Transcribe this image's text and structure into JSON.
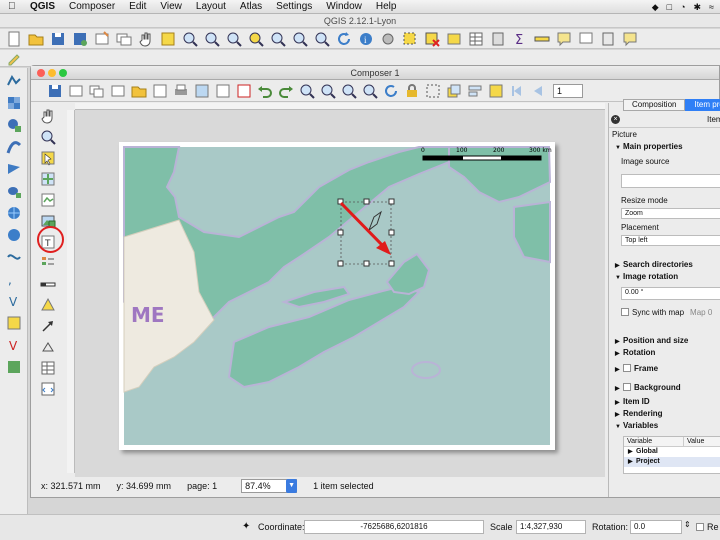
{
  "menubar": {
    "items": [
      "QGIS",
      "Composer",
      "Edit",
      "View",
      "Layout",
      "Atlas",
      "Settings",
      "Window",
      "Help"
    ]
  },
  "main_window": {
    "title": "QGIS 2.12.1-Lyon"
  },
  "composer": {
    "title": "Composer 1",
    "page_number": "1",
    "map": {
      "scalebar_ticks": [
        "0",
        "100",
        "200",
        "300 km"
      ],
      "label_me": "ME"
    }
  },
  "status": {
    "x": "x: 321.571 mm",
    "y": "y: 34.699 mm",
    "page": "page: 1",
    "zoom": "87.4%",
    "selection": "1 item selected"
  },
  "right_panel": {
    "tab_composition": "Composition",
    "tab_item": "Item pro",
    "header": "Item",
    "section_title": "Picture",
    "main_properties": "Main properties",
    "image_source_label": "Image source",
    "resize_mode_label": "Resize mode",
    "resize_mode_value": "Zoom",
    "placement_label": "Placement",
    "placement_value": "Top left",
    "search_directories": "Search directories",
    "image_rotation": "Image rotation",
    "rotation_value": "0.00 °",
    "sync_with_map": "Sync with map",
    "sync_map_value": "Map 0",
    "position_and_size": "Position and size",
    "rotation": "Rotation",
    "frame": "Frame",
    "background": "Background",
    "item_id": "Item ID",
    "rendering": "Rendering",
    "variables": "Variables",
    "var_col_variable": "Variable",
    "var_col_value": "Value",
    "var_global": "Global",
    "var_project": "Project"
  },
  "bottom_bar": {
    "coordinate_label": "Coordinate:",
    "coordinate_value": "-7625686,6201816",
    "scale_label": "Scale",
    "scale_value": "1:4,327,930",
    "rotation_label": "Rotation:",
    "rotation_value": "0.0",
    "render_label": "Re"
  },
  "colors": {
    "land": "#7fbfa8",
    "water": "#a9c9c7",
    "outline": "#b9b3d6",
    "us_land": "#eeeae0",
    "arrow": "#e01b1b",
    "highlight": "#e02020",
    "accent": "#2f7ff6"
  }
}
